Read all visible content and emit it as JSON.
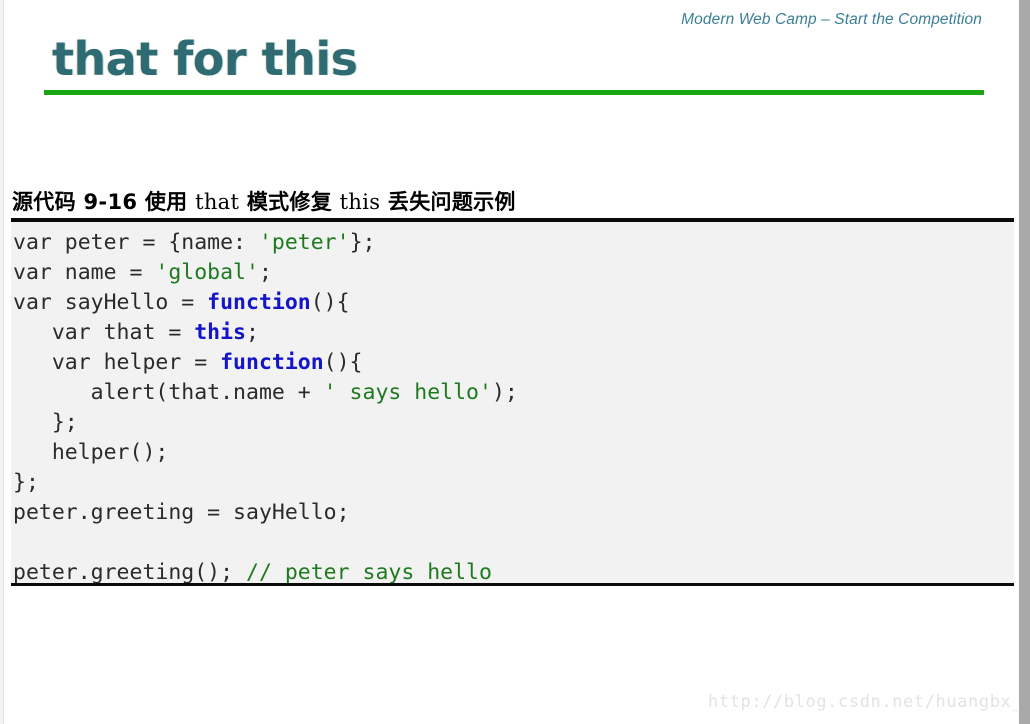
{
  "slide": {
    "header_note": "Modern Web Camp – Start the Competition",
    "title": "that for this",
    "accent_color": "#17a511",
    "title_color": "#2e6b72",
    "header_note_color": "#3b7f96"
  },
  "code_caption": {
    "prefix": "源代码  9-16  使用 ",
    "that": "that",
    "middle": " 模式修复 ",
    "this": "this",
    "suffix": " 丢失问题示例",
    "full": "源代码 9-16 使用 that 模式修复 this 丢失问题示例"
  },
  "code": {
    "language": "javascript",
    "keyword_color": "#1414c8",
    "string_color": "#1e7a1e",
    "comment_color": "#1e7a1e",
    "background": "#f2f2f2",
    "lines": [
      {
        "segments": [
          {
            "t": "var peter = {name: ",
            "k": "plain"
          },
          {
            "t": "'peter'",
            "k": "str"
          },
          {
            "t": "};",
            "k": "plain"
          }
        ]
      },
      {
        "segments": [
          {
            "t": "var name = ",
            "k": "plain"
          },
          {
            "t": "'global'",
            "k": "str"
          },
          {
            "t": ";",
            "k": "plain"
          }
        ]
      },
      {
        "segments": [
          {
            "t": "var sayHello = ",
            "k": "plain"
          },
          {
            "t": "function",
            "k": "kw"
          },
          {
            "t": "(){",
            "k": "plain"
          }
        ]
      },
      {
        "segments": [
          {
            "t": "   var that = ",
            "k": "plain"
          },
          {
            "t": "this",
            "k": "kw"
          },
          {
            "t": ";",
            "k": "plain"
          }
        ]
      },
      {
        "segments": [
          {
            "t": "   var helper = ",
            "k": "plain"
          },
          {
            "t": "function",
            "k": "kw"
          },
          {
            "t": "(){",
            "k": "plain"
          }
        ]
      },
      {
        "segments": [
          {
            "t": "      alert(that.name + ",
            "k": "plain"
          },
          {
            "t": "' says hello'",
            "k": "str"
          },
          {
            "t": ");",
            "k": "plain"
          }
        ]
      },
      {
        "segments": [
          {
            "t": "   };",
            "k": "plain"
          }
        ]
      },
      {
        "segments": [
          {
            "t": "   helper();",
            "k": "plain"
          }
        ]
      },
      {
        "segments": [
          {
            "t": "};",
            "k": "plain"
          }
        ]
      },
      {
        "segments": [
          {
            "t": "peter.greeting = sayHello;",
            "k": "plain"
          }
        ]
      },
      {
        "segments": [
          {
            "t": "",
            "k": "plain"
          }
        ]
      },
      {
        "segments": [
          {
            "t": "peter.greeting(); ",
            "k": "plain"
          },
          {
            "t": "// peter says hello",
            "k": "cmt"
          }
        ]
      }
    ]
  },
  "watermark": {
    "text": "http://blog.csdn.net/huangbx_tx"
  }
}
